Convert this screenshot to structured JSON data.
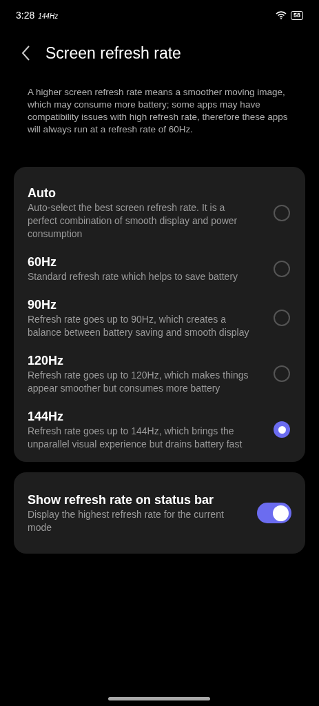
{
  "status_bar": {
    "time": "3:28",
    "refresh": "144Hz",
    "battery": "58"
  },
  "header": {
    "title": "Screen refresh rate"
  },
  "description": "A higher screen refresh rate means a smoother moving image, which may consume more battery; some apps may have compatibility issues with high refresh rate, therefore these apps will always run at a refresh rate of 60Hz.",
  "options": [
    {
      "title": "Auto",
      "description": "Auto-select the best screen refresh rate. It is a perfect combination of smooth display and power consumption",
      "selected": false
    },
    {
      "title": "60Hz",
      "description": "Standard refresh rate which helps to save battery",
      "selected": false
    },
    {
      "title": "90Hz",
      "description": "Refresh rate goes up to 90Hz, which creates a balance between battery saving and smooth display",
      "selected": false
    },
    {
      "title": "120Hz",
      "description": "Refresh rate goes up to 120Hz, which makes things appear smoother but consumes more battery",
      "selected": false
    },
    {
      "title": "144Hz",
      "description": "Refresh rate goes up to 144Hz, which brings the unparallel visual experience but drains battery fast",
      "selected": true
    }
  ],
  "status_bar_setting": {
    "title": "Show refresh rate on status bar",
    "description": "Display the highest refresh rate for the current mode",
    "on": true
  }
}
